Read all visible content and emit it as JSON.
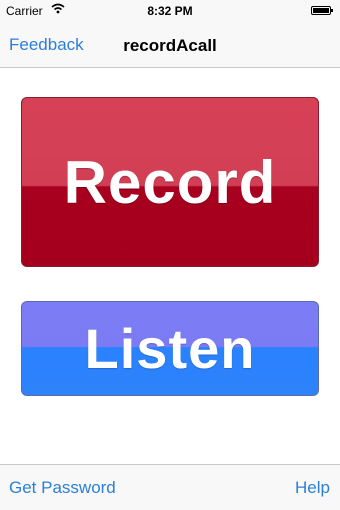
{
  "status_bar": {
    "carrier": "Carrier",
    "time": "8:32 PM",
    "icons": [
      "wifi-icon",
      "battery-icon"
    ],
    "battery_level": 1.0
  },
  "nav": {
    "back_label": "Feedback",
    "title": "recordAcall"
  },
  "main": {
    "record_label": "Record",
    "listen_label": "Listen"
  },
  "toolbar": {
    "left_label": "Get Password",
    "right_label": "Help"
  },
  "colors": {
    "tint": "#2b7fd6",
    "record_button": "#a8001f",
    "listen_button": "#2a82ff"
  }
}
